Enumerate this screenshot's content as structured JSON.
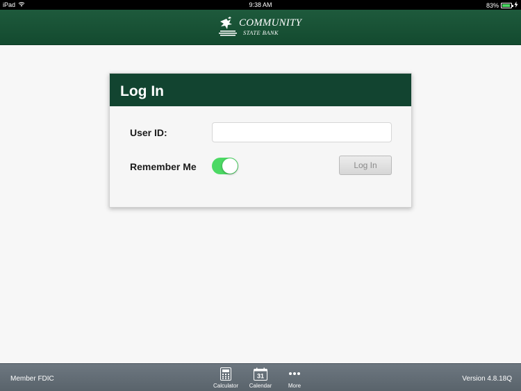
{
  "status_bar": {
    "device": "iPad",
    "time": "9:38 AM",
    "battery_percent": "83%",
    "battery_level": 0.83
  },
  "header": {
    "logo_line1": "COMMUNITY",
    "logo_line2": "STATE BANK",
    "brand_color": "#134a2f"
  },
  "login": {
    "title": "Log In",
    "user_id_label": "User ID:",
    "user_id_value": "",
    "remember_label": "Remember Me",
    "remember_on": true,
    "login_button_label": "Log In"
  },
  "footer": {
    "member_fdic": "Member FDIC",
    "version": "Version 4.8.18Q",
    "tabs": [
      {
        "label": "Calculator",
        "icon": "calculator-icon"
      },
      {
        "label": "Calendar",
        "icon": "calendar-icon",
        "icon_text": "31"
      },
      {
        "label": "More",
        "icon": "more-icon"
      }
    ]
  }
}
